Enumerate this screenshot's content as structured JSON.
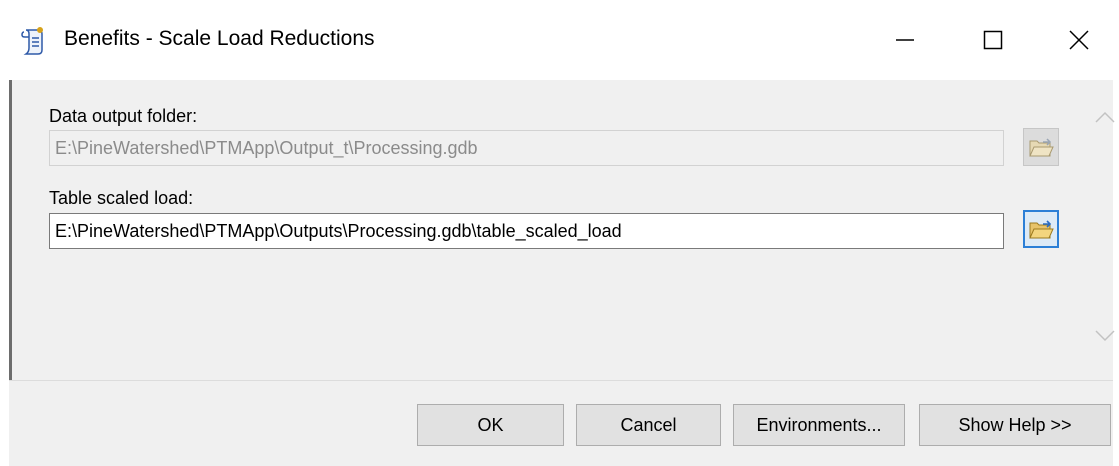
{
  "window": {
    "title": "Benefits - Scale Load Reductions",
    "icon": "script-tool-icon",
    "controls": [
      "minimize-icon",
      "maximize-icon",
      "close-icon"
    ]
  },
  "form": {
    "data_output_folder": {
      "label": "Data output folder:",
      "value": "E:\\PineWatershed\\PTMApp\\Output_t\\Processing.gdb",
      "enabled": false
    },
    "table_scaled_load": {
      "label": "Table scaled load:",
      "value": "E:\\PineWatershed\\PTMApp\\Outputs\\Processing.gdb\\table_scaled_load",
      "enabled": true
    }
  },
  "buttons": {
    "ok": "OK",
    "cancel": "Cancel",
    "environments": "Environments...",
    "show_help": "Show Help >>"
  },
  "colors": {
    "focus_border": "#2c7fd6",
    "folder_icon": "#e7c36a",
    "disabled_text": "#8b8b8b"
  }
}
